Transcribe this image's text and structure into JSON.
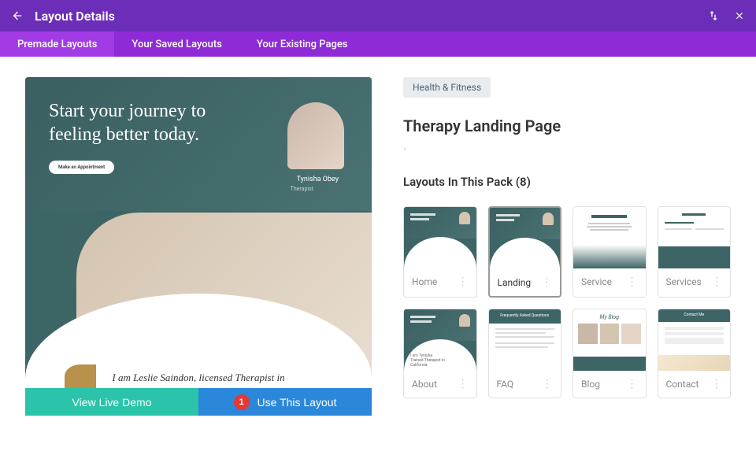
{
  "header": {
    "title": "Layout Details"
  },
  "tabs": {
    "items": [
      {
        "label": "Premade Layouts",
        "active": true
      },
      {
        "label": "Your Saved Layouts",
        "active": false
      },
      {
        "label": "Your Existing Pages",
        "active": false
      }
    ]
  },
  "preview": {
    "headline": "Start your journey to feeling better today.",
    "cta_pill": "Make an Appointment",
    "avatar_name": "Tynisha Obey",
    "avatar_role": "Therapist",
    "bottom_text": "I am Leslie Saindon, licensed Therapist in",
    "demo_label": "View Live Demo",
    "use_label": "Use This Layout",
    "step_badge": "1"
  },
  "details": {
    "category": "Health & Fitness",
    "title": "Therapy Landing Page",
    "subtitle": ".",
    "pack_title": "Layouts In This Pack (8)",
    "layouts": [
      {
        "name": "Home",
        "type": "hero"
      },
      {
        "name": "Landing",
        "type": "hero",
        "active": true
      },
      {
        "name": "Service",
        "type": "text"
      },
      {
        "name": "Services",
        "type": "text"
      },
      {
        "name": "About",
        "type": "hero"
      },
      {
        "name": "FAQ",
        "type": "text"
      },
      {
        "name": "Blog",
        "type": "blog"
      },
      {
        "name": "Contact",
        "type": "text"
      }
    ]
  }
}
